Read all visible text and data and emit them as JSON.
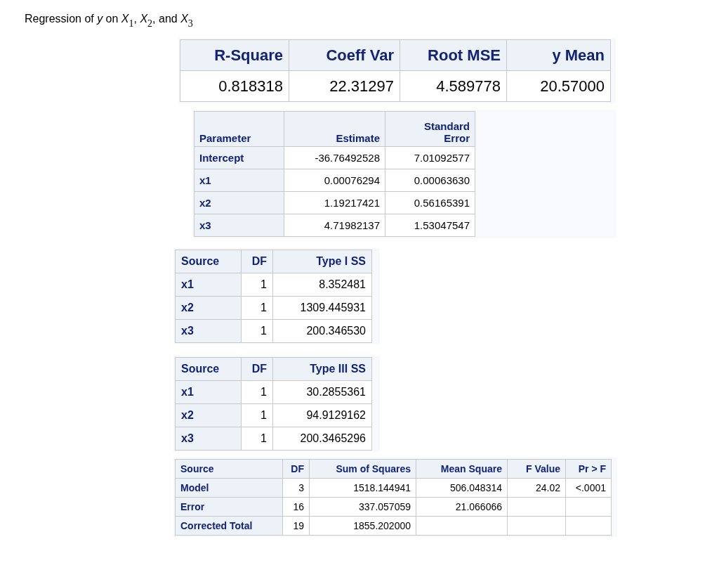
{
  "title": "Regression of *y* on *X*$_{1}$, *X*$_{2}$, and *X*$_{3}$",
  "tables": [
    {
      "columns": [
        "R-Square",
        "Coeff Var",
        "Root MSE",
        "y Mean"
      ],
      "rows": [
        [
          "0.818318",
          "22.31297",
          "4.589778",
          "20.57000"
        ]
      ]
    },
    {
      "columns": [
        "Parameter",
        "Estimate",
        "Standard Error"
      ],
      "rows": [
        [
          "Intercept",
          "-36.76492528",
          "7.01092577"
        ],
        [
          "x1",
          "0.00076294",
          "0.00063630"
        ],
        [
          "x2",
          "1.19217421",
          "0.56165391"
        ],
        [
          "x3",
          "4.71982137",
          "1.53047547"
        ]
      ]
    },
    {
      "columns": [
        "Source",
        "DF",
        "Type I SS"
      ],
      "rows": [
        [
          "x1",
          "1",
          "8.352481"
        ],
        [
          "x2",
          "1",
          "1309.445931"
        ],
        [
          "x3",
          "1",
          "200.346530"
        ]
      ]
    },
    {
      "columns": [
        "Source",
        "DF",
        "Type III SS"
      ],
      "rows": [
        [
          "x1",
          "1",
          "30.2855361"
        ],
        [
          "x2",
          "1",
          "94.9129162"
        ],
        [
          "x3",
          "1",
          "200.3465296"
        ]
      ]
    },
    {
      "columns": [
        "Source",
        "DF",
        "Sum of Squares",
        "Mean Square",
        "F Value",
        "Pr > F"
      ],
      "rows": [
        [
          "Model",
          "3",
          "1518.144941",
          "506.048314",
          "24.02",
          "<.0001"
        ],
        [
          "Error",
          "16",
          "337.057059",
          "21.066066"
        ],
        [
          "Corrected Total",
          "19",
          "1855.202000"
        ]
      ]
    }
  ]
}
